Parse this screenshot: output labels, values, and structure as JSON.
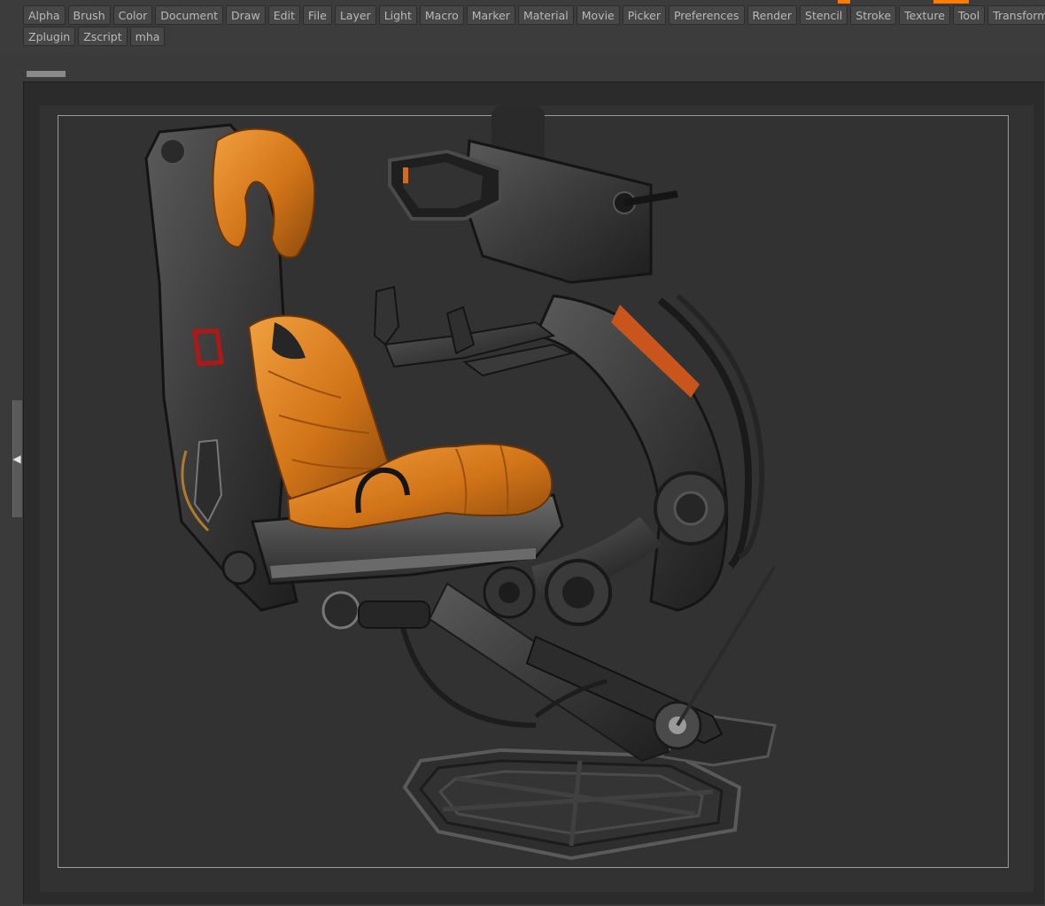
{
  "menubar": {
    "row1": [
      "Alpha",
      "Brush",
      "Color",
      "Document",
      "Draw",
      "Edit",
      "File",
      "Layer",
      "Light",
      "Macro",
      "Marker",
      "Material",
      "Movie",
      "Picker",
      "Preferences",
      "Render",
      "Stencil",
      "Stroke",
      "Texture",
      "Tool",
      "Transform"
    ],
    "row2": [
      "Zplugin",
      "Zscript",
      "mha"
    ]
  },
  "colors": {
    "accent": "#ff7a00",
    "ui_bg": "#3a3a3a",
    "canvas_bg": "#323232",
    "seat_leather": "#d97a1c",
    "metal_dark": "#3e3e3e"
  },
  "icons": {
    "left_panel_toggle": "chevron-left-icon"
  },
  "canvas": {
    "subject": "cockpit seat 3D model"
  }
}
